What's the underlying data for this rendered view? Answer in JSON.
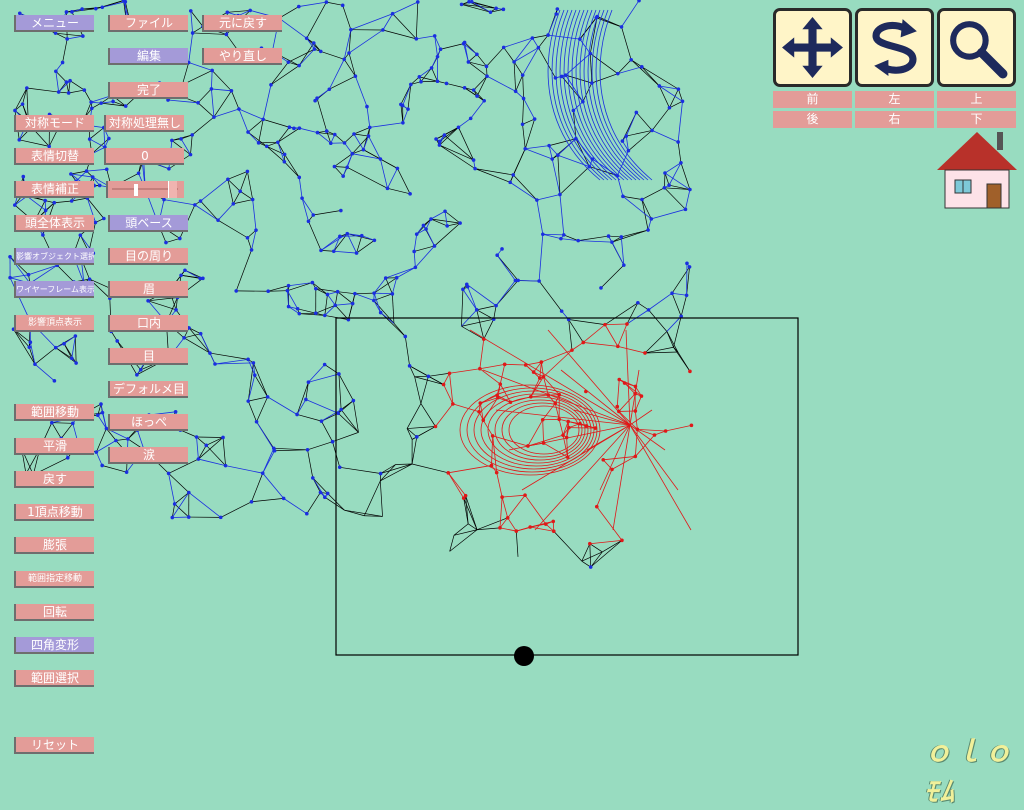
{
  "menu": {
    "menu_label": "メニュー",
    "file_label": "ファイル",
    "undo_label": "元に戻す",
    "edit_label": "編集",
    "redo_label": "やり直し",
    "done_label": "完了"
  },
  "left_tools": {
    "symmetry_mode": "対称モード",
    "symmetry_value": "対称処理無し",
    "expression_switch": "表情切替",
    "expression_value": "0",
    "expression_correct": "表情補正",
    "head_display": "頭全体表示",
    "head_base": "頭ベース",
    "affect_object_select": "影響オブジェクト選択",
    "around_eyes": "目の周り",
    "wireframe_display": "ワイヤーフレーム表示",
    "eyebrow": "眉",
    "affect_vertex_display": "影響頂点表示",
    "mouth_inside": "口内",
    "eye": "目",
    "deformed_eye": "デフォルメ目",
    "cheek": "ほっぺ",
    "tear": "涙",
    "range_move": "範囲移動",
    "smooth": "平滑",
    "revert": "戻す",
    "single_vertex_move": "1頂点移動",
    "inflate": "膨張",
    "range_specified_move": "範囲指定移動",
    "rotate": "回転",
    "quad_deform": "四角変形",
    "range_select": "範囲選択",
    "reset": "リセット"
  },
  "view_tools": {
    "icons": [
      "move-cross-icon",
      "rotate-arrows-icon",
      "zoom-magnifier-icon"
    ],
    "front": "前",
    "left": "左",
    "top": "上",
    "back": "後",
    "right": "右",
    "bottom": "下"
  },
  "logo_text": "ｏｌｏﾓﾑ",
  "colors": {
    "background": "#98dcc0",
    "button": "#e39c98",
    "button_selected": "#a49ad8",
    "mesh_black": "#000000",
    "mesh_blue": "#1a2ee0",
    "mesh_red": "#e01818"
  }
}
